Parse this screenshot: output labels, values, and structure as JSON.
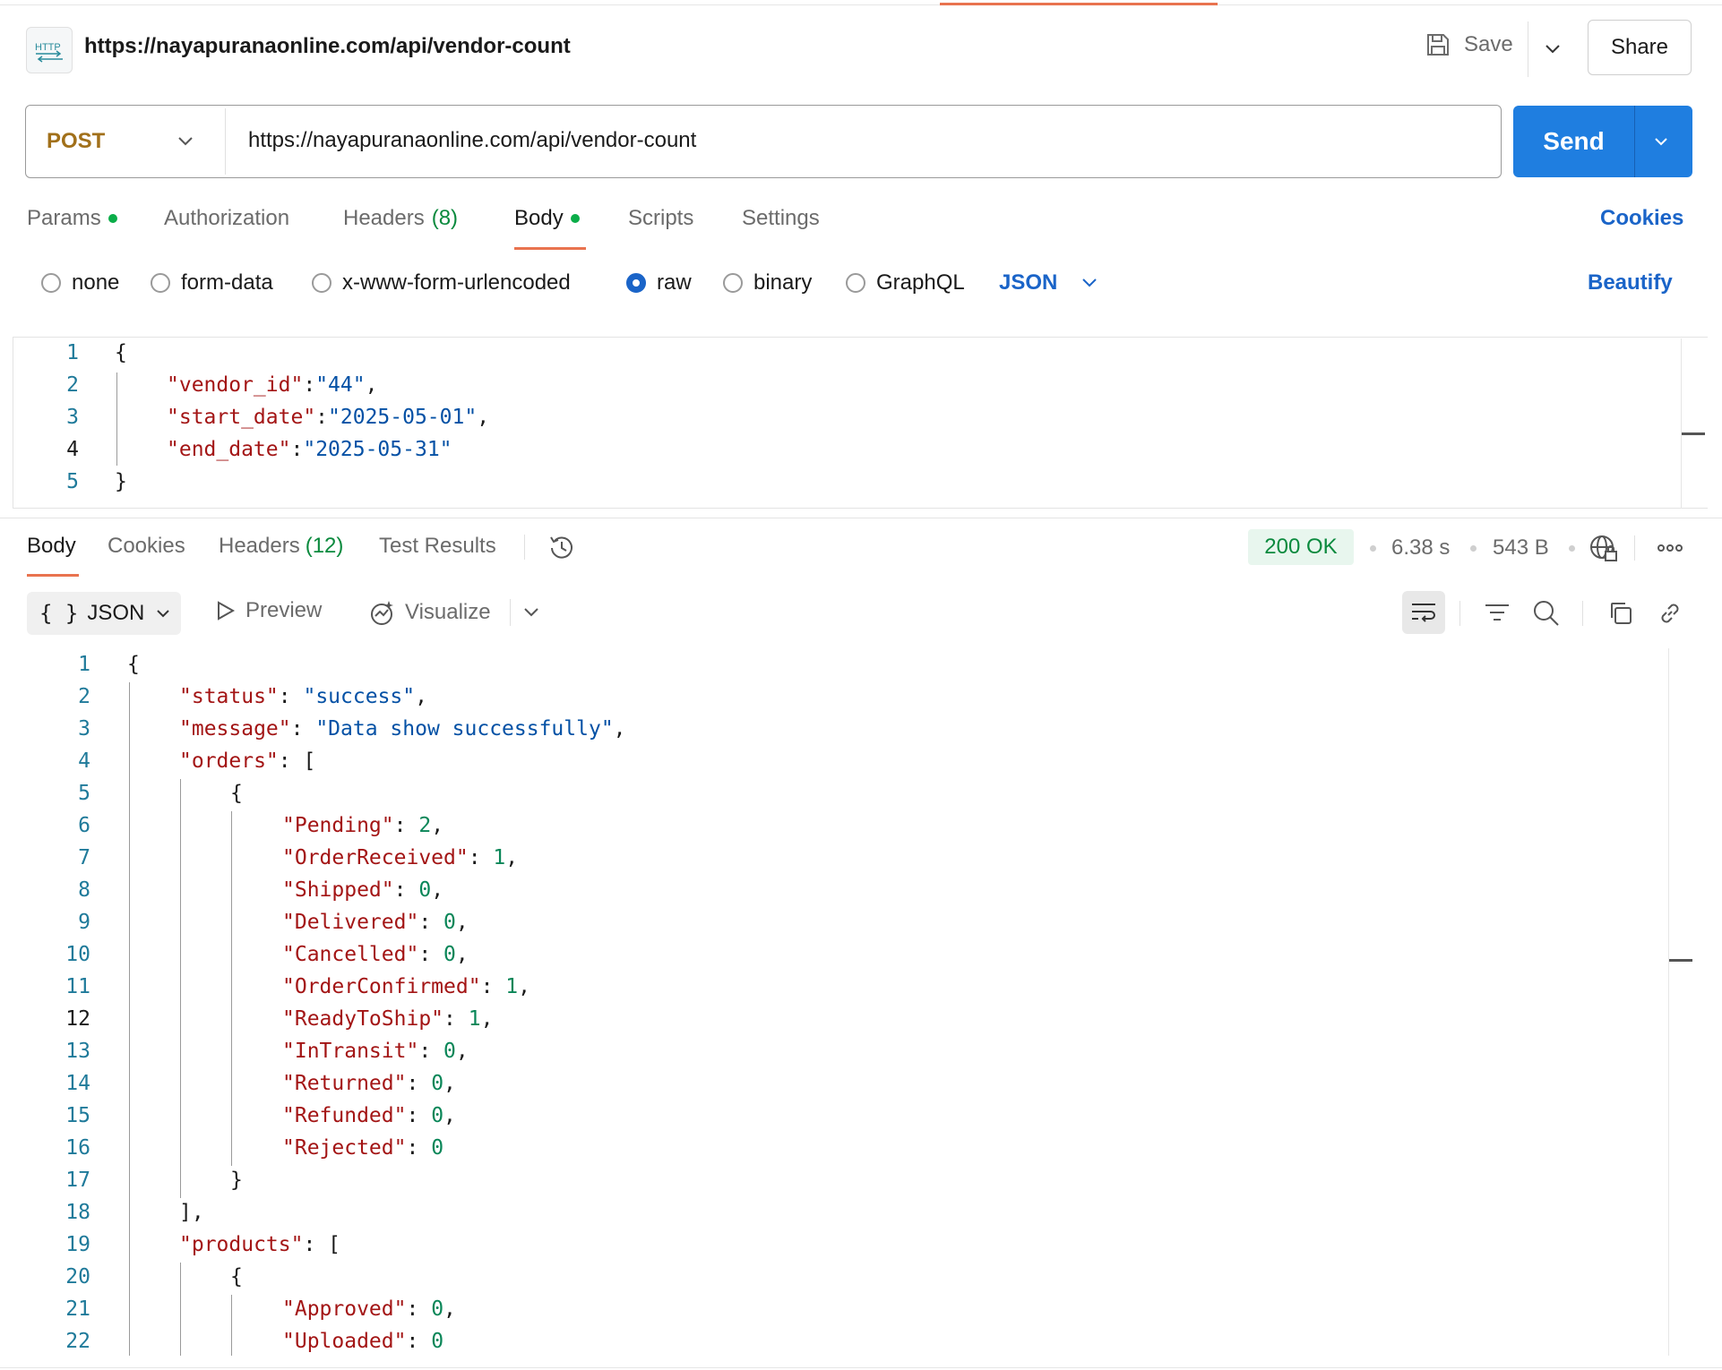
{
  "header": {
    "title": "https://nayapuranaonline.com/api/vendor-count",
    "save_label": "Save",
    "share_label": "Share"
  },
  "request": {
    "method": "POST",
    "url": "https://nayapuranaonline.com/api/vendor-count",
    "send_label": "Send"
  },
  "request_tabs": {
    "params": "Params",
    "authorization": "Authorization",
    "headers": "Headers",
    "headers_count": "(8)",
    "body": "Body",
    "scripts": "Scripts",
    "settings": "Settings",
    "cookies": "Cookies"
  },
  "body_types": {
    "none": "none",
    "form_data": "form-data",
    "urlencoded": "x-www-form-urlencoded",
    "raw": "raw",
    "binary": "binary",
    "graphql": "GraphQL",
    "format": "JSON",
    "beautify": "Beautify"
  },
  "request_body": {
    "line_numbers": [
      "1",
      "2",
      "3",
      "4",
      "5"
    ],
    "open": "{",
    "close": "}",
    "k1": "\"vendor_id\"",
    "v1": "\"44\"",
    "k2": "\"start_date\"",
    "v2": "\"2025-05-01\"",
    "k3": "\"end_date\"",
    "v3": "\"2025-05-31\""
  },
  "response_tabs": {
    "body": "Body",
    "cookies": "Cookies",
    "headers": "Headers",
    "headers_count": "(12)",
    "test_results": "Test Results"
  },
  "response_meta": {
    "status": "200 OK",
    "time": "6.38 s",
    "size": "543 B"
  },
  "response_toolbar": {
    "format": "JSON",
    "preview": "Preview",
    "visualize": "Visualize"
  },
  "response_body": {
    "line_numbers": [
      "1",
      "2",
      "3",
      "4",
      "5",
      "6",
      "7",
      "8",
      "9",
      "10",
      "11",
      "12",
      "13",
      "14",
      "15",
      "16",
      "17",
      "18",
      "19",
      "20",
      "21",
      "22"
    ],
    "status_key": "\"status\"",
    "status_val": "\"success\"",
    "message_key": "\"message\"",
    "message_val": "\"Data show successfully\"",
    "orders_key": "\"orders\"",
    "products_key": "\"products\"",
    "orders": [
      {
        "k": "\"Pending\"",
        "v": "2"
      },
      {
        "k": "\"OrderReceived\"",
        "v": "1"
      },
      {
        "k": "\"Shipped\"",
        "v": "0"
      },
      {
        "k": "\"Delivered\"",
        "v": "0"
      },
      {
        "k": "\"Cancelled\"",
        "v": "0"
      },
      {
        "k": "\"OrderConfirmed\"",
        "v": "1"
      },
      {
        "k": "\"ReadyToShip\"",
        "v": "1"
      },
      {
        "k": "\"InTransit\"",
        "v": "0"
      },
      {
        "k": "\"Returned\"",
        "v": "0"
      },
      {
        "k": "\"Refunded\"",
        "v": "0"
      },
      {
        "k": "\"Rejected\"",
        "v": "0"
      }
    ],
    "products": [
      {
        "k": "\"Approved\"",
        "v": "0"
      },
      {
        "k": "\"Uploaded\"",
        "v": "0"
      }
    ]
  },
  "colors": {
    "accent": "#e9734f",
    "send": "#1f7ee0",
    "method": "#a1701a",
    "link": "#1a64c8",
    "success": "#0b8a3e"
  }
}
